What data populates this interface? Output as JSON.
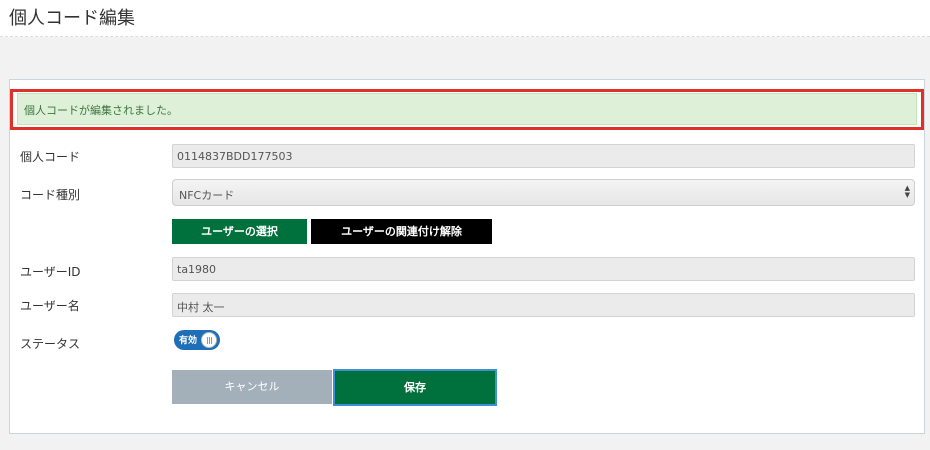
{
  "header": {
    "title": "個人コード編集"
  },
  "alert": {
    "message": "個人コードが編集されました。"
  },
  "form": {
    "personal_code": {
      "label": "個人コード",
      "value": "0114837BDD177503"
    },
    "code_type": {
      "label": "コード種別",
      "selected": "NFCカード"
    },
    "user_buttons": {
      "select_label": "ユーザーの選択",
      "unlink_label": "ユーザーの関連付け解除"
    },
    "user_id": {
      "label": "ユーザーID",
      "value": "ta1980"
    },
    "user_name": {
      "label": "ユーザー名",
      "value": "中村 太一"
    },
    "status": {
      "label": "ステータス",
      "toggle_label": "有効",
      "enabled": true
    }
  },
  "actions": {
    "cancel_label": "キャンセル",
    "save_label": "保存"
  },
  "colors": {
    "primary_green": "#00703c",
    "alert_bg": "#dff0d8",
    "alert_text": "#3c763d",
    "highlight_border": "#e0302a",
    "toggle_blue": "#1e6fb8",
    "cancel_gray": "#a3b0ba"
  },
  "icons": {
    "select_arrows": "updown-arrows-icon",
    "toggle_grip": "grip-icon"
  }
}
